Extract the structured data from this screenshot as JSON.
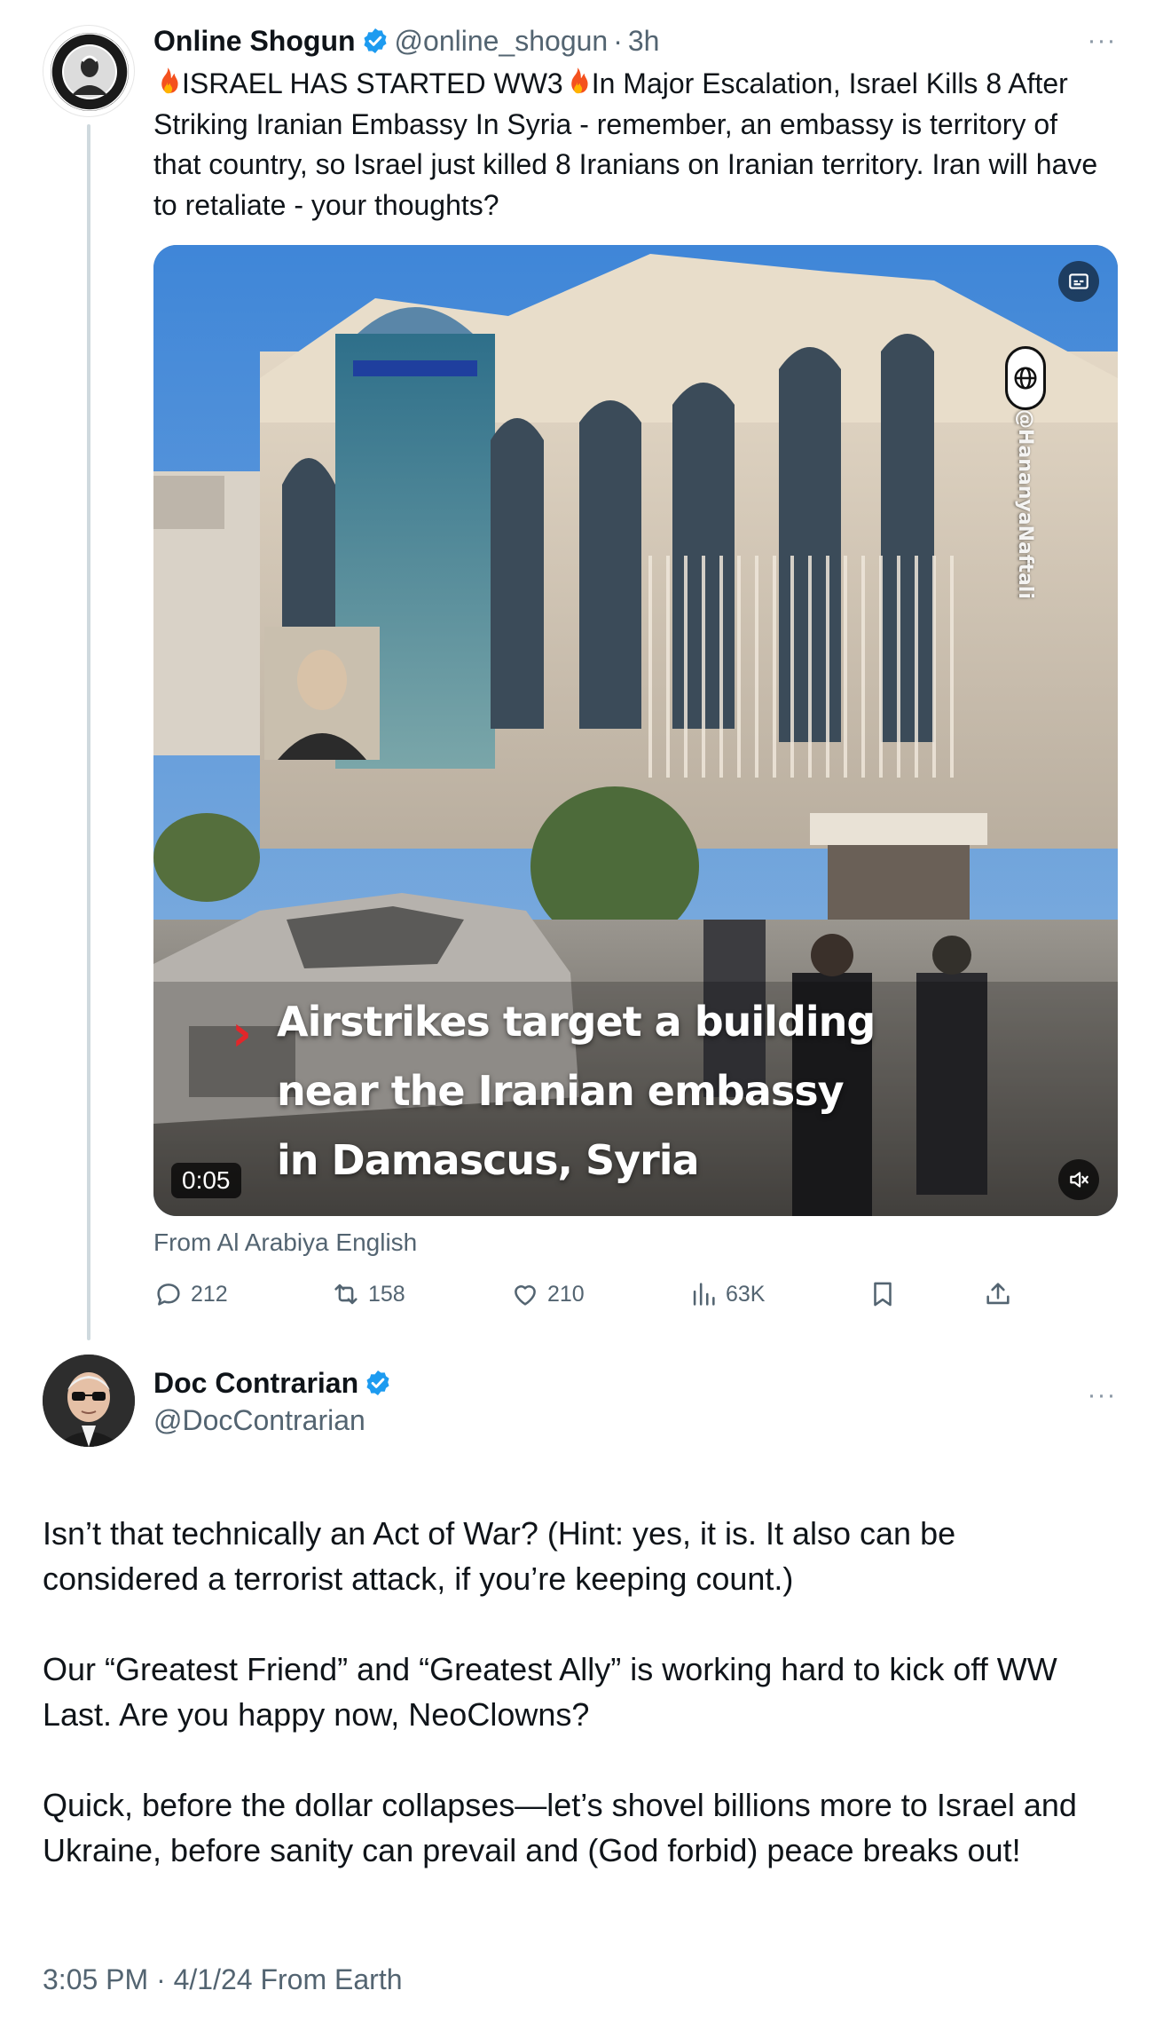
{
  "parent_tweet": {
    "author_name": "Online Shogun",
    "handle": "@online_shogun",
    "separator": "·",
    "time_ago": "3h",
    "avatar_ring_text_top": "HATED FOR STYLE",
    "avatar_ring_text_bottom": "THE PREACHERS",
    "text_fire_icon": "fire-emoji",
    "text_part1": "ISRAEL HAS STARTED WW3",
    "text_part2": "In Major Escalation, Israel Kills 8 After Striking Iranian Embassy In Syria - remember, an embassy is territory of that country, so Israel just killed 8 Iranians on Iranian territory. Iran will have to retaliate - your thoughts?",
    "video": {
      "caption_line1": "Airstrikes target a building",
      "caption_line2": "near the Iranian embassy",
      "caption_line3": "in Damascus, Syria",
      "duration": "0:05",
      "watermark": "@HananyaNaftali"
    },
    "source_label": "From Al Arabiya English",
    "stats": {
      "replies": "212",
      "reposts": "158",
      "likes": "210",
      "views": "63K"
    }
  },
  "main_tweet": {
    "author_name": "Doc Contrarian",
    "handle": "@DocContrarian",
    "paragraph1": "Isn’t that technically an Act of War? (Hint: yes, it is. It also can be considered a terrorist attack, if you’re keeping count.)",
    "paragraph2": "Our “Greatest Friend” and “Greatest Ally” is working hard to kick off WW Last. Are you happy now, NeoClowns?",
    "paragraph3": "Quick, before the dollar collapses—let’s shovel billions more to Israel and Ukraine, before sanity can prevail and (God forbid) peace breaks out!",
    "time": "3:05 PM",
    "meta_separator": "·",
    "date": "4/1/24",
    "client": "From Earth"
  },
  "colors": {
    "text_primary": "#0f1419",
    "text_secondary": "#536471",
    "verified_blue": "#1d9bf0",
    "thread_line": "#cfd9de",
    "caption_arrow_red": "#e2262a"
  },
  "more_label": "···"
}
